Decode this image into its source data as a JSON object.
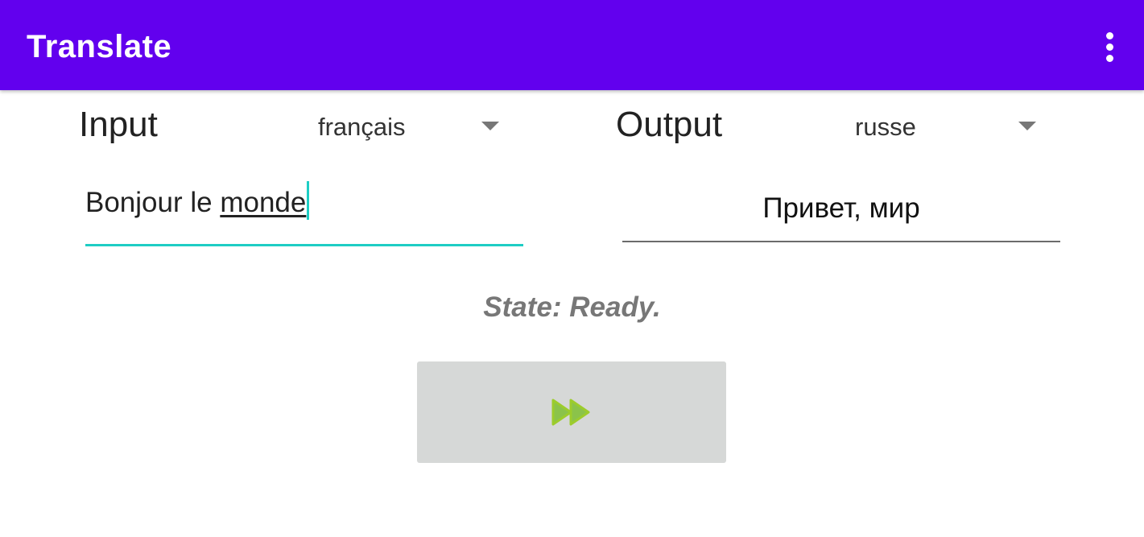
{
  "app_bar": {
    "title": "Translate",
    "background": "#6200EE",
    "overflow_icon": "more-vert-icon"
  },
  "input": {
    "label": "Input",
    "language": "français",
    "text_plain": "Bonjour le ",
    "text_underlined": "monde",
    "accent": "#1ECDC4"
  },
  "output": {
    "label": "Output",
    "language": "russe",
    "text": "Привет, мир"
  },
  "state": {
    "text": "State: Ready."
  },
  "translate_button": {
    "icon": "fast-forward-icon",
    "icon_color": "#8BC34A",
    "background": "#d6d8d7"
  }
}
